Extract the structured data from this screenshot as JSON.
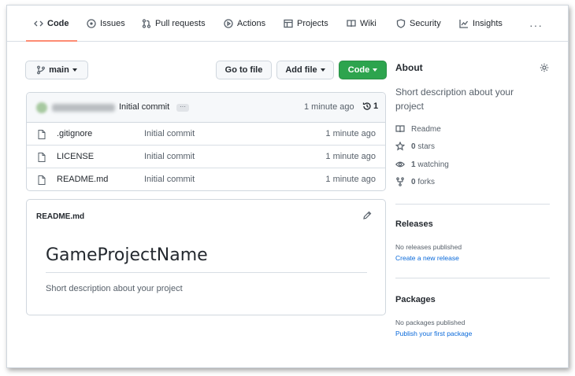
{
  "nav": {
    "tabs": [
      {
        "label": "Code",
        "icon": "code-icon"
      },
      {
        "label": "Issues",
        "icon": "issue-icon"
      },
      {
        "label": "Pull requests",
        "icon": "pull-request-icon"
      },
      {
        "label": "Actions",
        "icon": "play-icon"
      },
      {
        "label": "Projects",
        "icon": "table-icon"
      },
      {
        "label": "Wiki",
        "icon": "book-icon"
      },
      {
        "label": "Security",
        "icon": "shield-icon"
      },
      {
        "label": "Insights",
        "icon": "graph-icon"
      }
    ],
    "more": "···"
  },
  "toolbar": {
    "branch": "main",
    "go_to_file": "Go to file",
    "add_file": "Add file",
    "code": "Code"
  },
  "latest_commit": {
    "message": "Initial commit",
    "ellipsis": "···",
    "time": "1 minute ago",
    "commit_count": "1"
  },
  "files": [
    {
      "name": ".gitignore",
      "message": "Initial commit",
      "time": "1 minute ago"
    },
    {
      "name": "LICENSE",
      "message": "Initial commit",
      "time": "1 minute ago"
    },
    {
      "name": "README.md",
      "message": "Initial commit",
      "time": "1 minute ago"
    }
  ],
  "readme": {
    "label": "README.md",
    "heading": "GameProjectName",
    "body": "Short description about your project"
  },
  "about": {
    "title": "About",
    "description": "Short description about your project",
    "readme": "Readme",
    "stars_count": "0",
    "stars_label": "stars",
    "watching_count": "1",
    "watching_label": "watching",
    "forks_count": "0",
    "forks_label": "forks"
  },
  "releases": {
    "title": "Releases",
    "empty": "No releases published",
    "link": "Create a new release"
  },
  "packages": {
    "title": "Packages",
    "empty": "No packages published",
    "link": "Publish your first package"
  },
  "colors": {
    "accent_underline": "#fd8c73",
    "primary_button": "#2da44e",
    "link": "#0969da"
  }
}
